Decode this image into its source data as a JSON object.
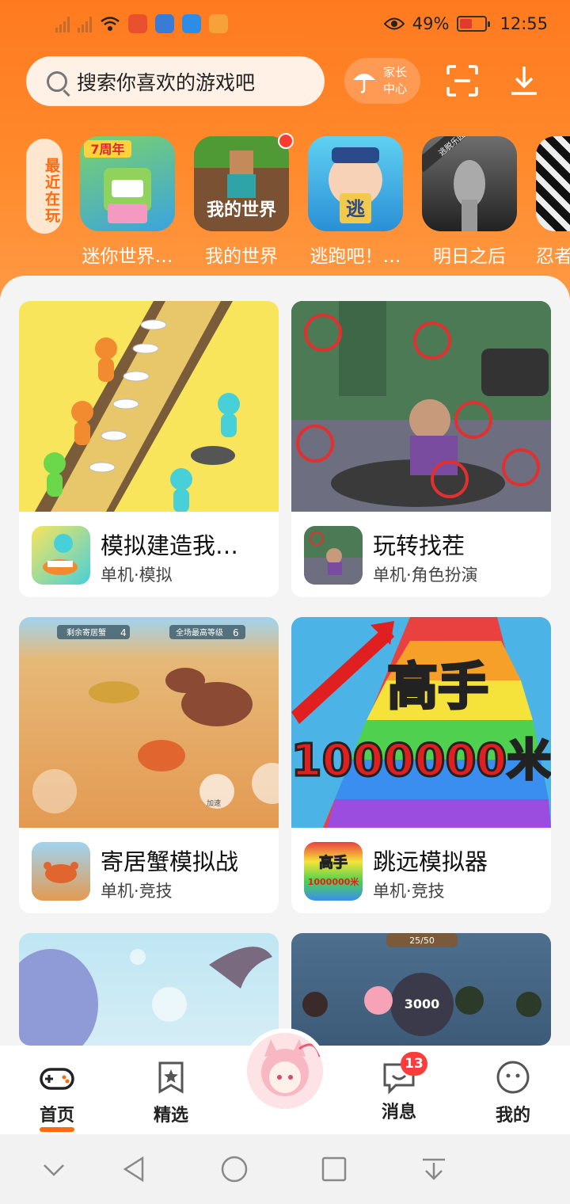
{
  "status_bar": {
    "battery": "49%",
    "time": "12:55"
  },
  "header": {
    "search_placeholder": "搜索你喜欢的游戏吧",
    "parent_center_line1": "家长",
    "parent_center_line2": "中心"
  },
  "recent": {
    "tag": "最近在玩",
    "games": [
      {
        "name": "迷你世界…",
        "badge": "7周年"
      },
      {
        "name": "我的世界",
        "badge": "我的世界"
      },
      {
        "name": "逃跑吧！…",
        "badge": "逃"
      },
      {
        "name": "明日之后",
        "badge": "逃脱乐园"
      },
      {
        "name": "忍者"
      }
    ]
  },
  "cards": [
    {
      "title": "模拟建造我…",
      "sub": "单机·模拟"
    },
    {
      "title": "玩转找茬",
      "sub": "单机·角色扮演"
    },
    {
      "title": "寄居蟹模拟战",
      "sub": "单机·竞技",
      "art_labels": [
        "剩余寄居蟹",
        "4",
        "全场最高等级",
        "6",
        "加速"
      ]
    },
    {
      "title": "跳远模拟器",
      "sub": "单机·竞技",
      "art_labels": [
        "高手",
        "1000000米"
      ]
    },
    {
      "art_labels": []
    },
    {
      "art_labels": [
        "25/50",
        "3000"
      ]
    }
  ],
  "tabbar": {
    "home": "首页",
    "featured": "精选",
    "messages": "消息",
    "messages_badge": "13",
    "mine": "我的"
  }
}
